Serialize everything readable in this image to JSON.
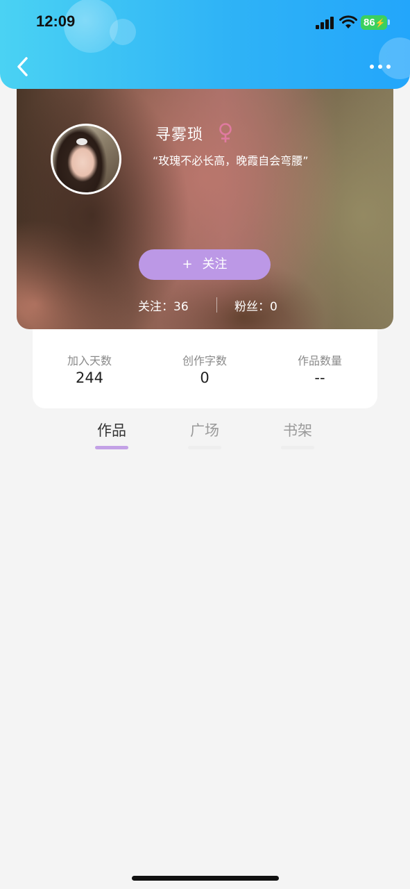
{
  "status_bar": {
    "time": "12:09",
    "battery": "86"
  },
  "header": {
    "back_icon": "chevron-left-icon",
    "more_icon": "more-dots-icon",
    "accent_color": "#2fb3f6"
  },
  "profile": {
    "nickname": "寻雾琐",
    "gender_icon": "female-icon",
    "gender_color": "#e07aa0",
    "motto": "“玫瑰不必长高，晚霞自会弯腰”",
    "follow_button": "+  关注",
    "follow_plus": "+",
    "follow_label": "关注",
    "follow_color": "#bc98e6",
    "following": "关注：36",
    "fans": "粉丝：0"
  },
  "stats": [
    {
      "label": "加入天数",
      "value": "244"
    },
    {
      "label": "创作字数",
      "value": "0"
    },
    {
      "label": "作品数量",
      "value": "--"
    }
  ],
  "tabs": [
    {
      "label": "作品",
      "active": true
    },
    {
      "label": "广场",
      "active": false
    },
    {
      "label": "书架",
      "active": false
    }
  ]
}
